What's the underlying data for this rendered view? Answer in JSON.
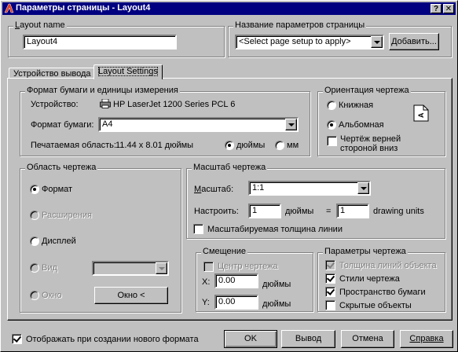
{
  "window": {
    "title": "Параметры страницы - Layout4",
    "help_btn": "?",
    "close_btn": "✕"
  },
  "layout_name": {
    "label": "Layout name",
    "value": "Layout4"
  },
  "page_setup_name": {
    "label": "Название параметров страницы",
    "value": "<Select page setup to apply>",
    "add_button": "Добавить..."
  },
  "tabs": [
    {
      "label": "Устройство вывода"
    },
    {
      "label": "Layout Settings"
    }
  ],
  "paper_size": {
    "title": "Формат бумаги и единицы измерения",
    "device_label": "Устройство:",
    "device_value": "HP LaserJet 1200 Series PCL 6",
    "paper_label": "Формат бумаги:",
    "paper_value": "A4",
    "printable_label": "Печатаемая область:",
    "printable_value": "11.44 x 8.01 дюймы",
    "inches": "дюймы",
    "mm": "мм"
  },
  "orientation": {
    "title": "Ориентация чертежа",
    "portrait": "Книжная",
    "landscape": "Альбомная",
    "upside_down": "Чертёж верней стороной вниз"
  },
  "plot_area": {
    "title": "Область чертежа",
    "layout": "Формат",
    "extents": "Расширения",
    "display": "Дисплей",
    "view": "Вид",
    "window": "Окно",
    "window_button": "Окно <"
  },
  "plot_scale": {
    "title": "Масштаб чертежа",
    "scale_label": "Масштаб:",
    "scale_value": "1:1",
    "custom_label": "Настроить:",
    "inches_value": "1",
    "inches_unit": "дюймы",
    "equals": "=",
    "units_value": "1",
    "units_unit": "drawing units",
    "scale_lineweights": "Масштабируемая толщина линии"
  },
  "plot_offset": {
    "title": "Смещение",
    "center": "Центр чертежа",
    "x_label": "X:",
    "x_value": "0.00",
    "x_unit": "дюймы",
    "y_label": "Y:",
    "y_value": "0.00",
    "y_unit": "дюймы"
  },
  "plot_options": {
    "title": "Параметры чертежа",
    "lineweights": "Толщина линий объекта",
    "styles": "Стили чертежа",
    "paperspace": "Пространство бумаги",
    "hidden": "Скрытые объекты"
  },
  "footer": {
    "show_on_create": "Отображать при создании нового формата",
    "ok": "OK",
    "plot": "Вывод",
    "cancel": "Отмена",
    "help": "Справка"
  },
  "icons": [
    "autocad-app-icon",
    "printer-icon",
    "landscape-page-icon"
  ]
}
